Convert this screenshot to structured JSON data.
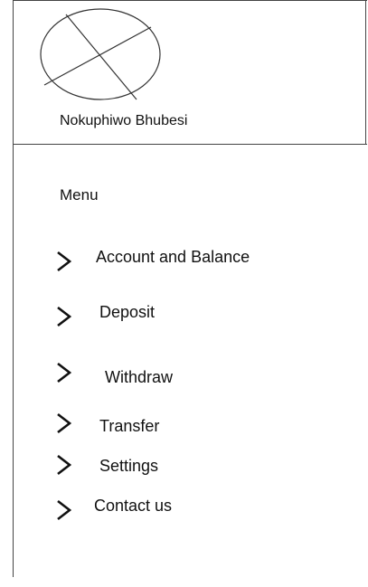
{
  "profile": {
    "name": "Nokuphiwo Bhubesi",
    "avatar_icon": "placeholder-image-icon"
  },
  "menu": {
    "title": "Menu",
    "chevron_icon": "chevron-right-icon",
    "items": [
      {
        "label": "Account and Balance"
      },
      {
        "label": "Deposit"
      },
      {
        "label": "Withdraw"
      },
      {
        "label": "Transfer"
      },
      {
        "label": "Settings"
      },
      {
        "label": "Contact us"
      }
    ]
  },
  "colors": {
    "line": "#444444",
    "text": "#111111",
    "background": "#ffffff"
  }
}
